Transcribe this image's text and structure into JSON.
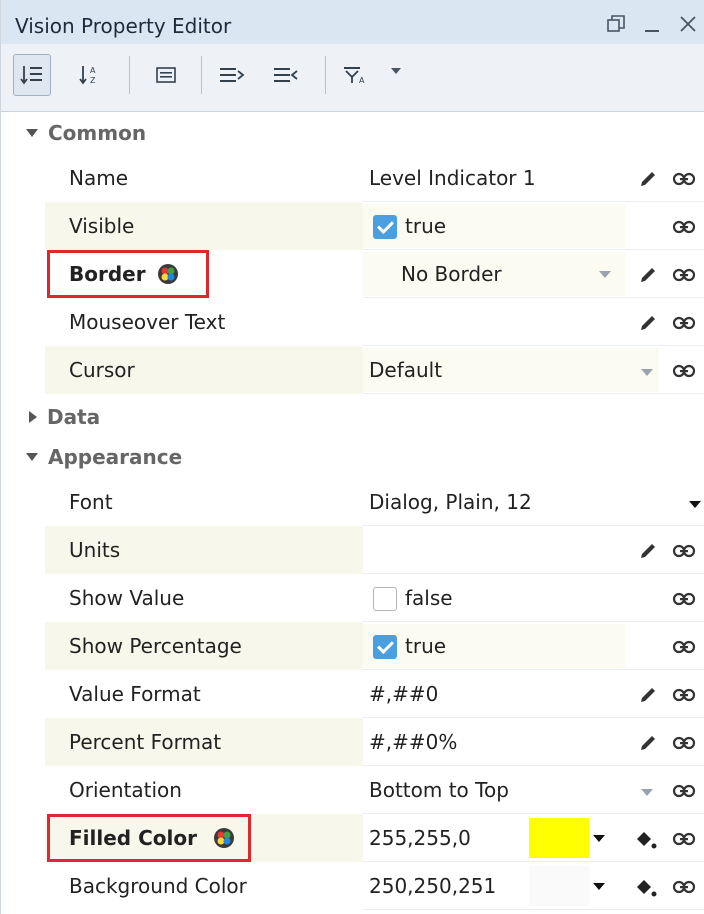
{
  "window": {
    "title": "Vision Property Editor"
  },
  "sections": {
    "common": "Common",
    "data": "Data",
    "appearance": "Appearance"
  },
  "common_rows": [
    {
      "name": "Name",
      "value": "Level Indicator 1"
    },
    {
      "name": "Visible",
      "value": "true",
      "checked": true
    },
    {
      "name": "Border",
      "value": "No Border"
    },
    {
      "name": "Mouseover Text",
      "value": ""
    },
    {
      "name": "Cursor",
      "value": "Default"
    }
  ],
  "appearance_rows": [
    {
      "name": "Font",
      "value": "Dialog, Plain, 12"
    },
    {
      "name": "Units",
      "value": ""
    },
    {
      "name": "Show Value",
      "value": "false",
      "checked": false
    },
    {
      "name": "Show Percentage",
      "value": "true",
      "checked": true
    },
    {
      "name": "Value Format",
      "value": "#,##0"
    },
    {
      "name": "Percent Format",
      "value": "#,##0%"
    },
    {
      "name": "Orientation",
      "value": "Bottom to Top"
    },
    {
      "name": "Filled Color",
      "value": "255,255,0",
      "swatch": "#ffff00"
    },
    {
      "name": "Background Color",
      "value": "250,250,251",
      "swatch": "#fafafb"
    }
  ],
  "colors": {
    "highlight_box": "#e0262f",
    "check_blue": "#4a9fe0",
    "titlebar": "#dbe6f3"
  },
  "icons": {
    "toolbar": [
      "sort-categorized-icon",
      "sort-alphabetical-icon",
      "details-icon",
      "expand-all-icon",
      "collapse-all-icon",
      "filter-icon"
    ],
    "row_actions": [
      "pencil-icon",
      "link-icon",
      "paint-bucket-icon",
      "color-palette-icon"
    ]
  }
}
